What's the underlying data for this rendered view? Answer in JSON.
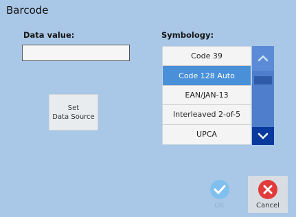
{
  "window": {
    "title": "Barcode"
  },
  "data_value": {
    "label": "Data value:",
    "value": "",
    "placeholder": ""
  },
  "symbology": {
    "label": "Symbology:",
    "items": [
      "Code 39",
      "Code 128 Auto",
      "EAN/JAN-13",
      "Interleaved 2-of-5",
      "UPCA"
    ],
    "selected": "Code 128 Auto"
  },
  "set_source": {
    "label": "Set\nData Source"
  },
  "scrollbar": {
    "up_icon": "chevron-up-icon",
    "down_icon": "chevron-down-icon"
  },
  "actions": {
    "ok_label": "OK",
    "cancel_label": "Cancel",
    "ok_enabled": false
  },
  "colors": {
    "background": "#a9c7e6",
    "selected_row": "#4a90d9",
    "scroll_down": "#083a9e",
    "ok_icon": "#7fc0ee",
    "cancel_icon": "#e23b3b"
  }
}
